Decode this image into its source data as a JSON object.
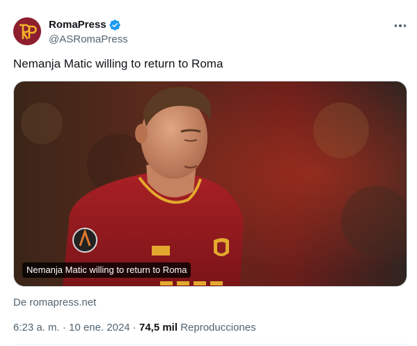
{
  "author": {
    "display_name": "RomaPress",
    "handle": "@ASRomaPress",
    "avatar_text": "RP",
    "verified_icon": "verified-badge-icon"
  },
  "tweet": {
    "text": "Nemanja Matic willing to return to Roma",
    "media_caption": "Nemanja Matic willing to return to Roma",
    "source_link": "De romapress.net"
  },
  "meta": {
    "time": "6:23 a. m.",
    "sep1": " · ",
    "date": "10 ene. 2024",
    "sep2": " · ",
    "views_count": "74,5 mil",
    "views_label": " Reproducciones"
  },
  "colors": {
    "brand_verified": "#1d9bf0",
    "avatar_bg": "#8e1f2f",
    "avatar_letters": "#f0b429",
    "muted_text": "#536471"
  }
}
